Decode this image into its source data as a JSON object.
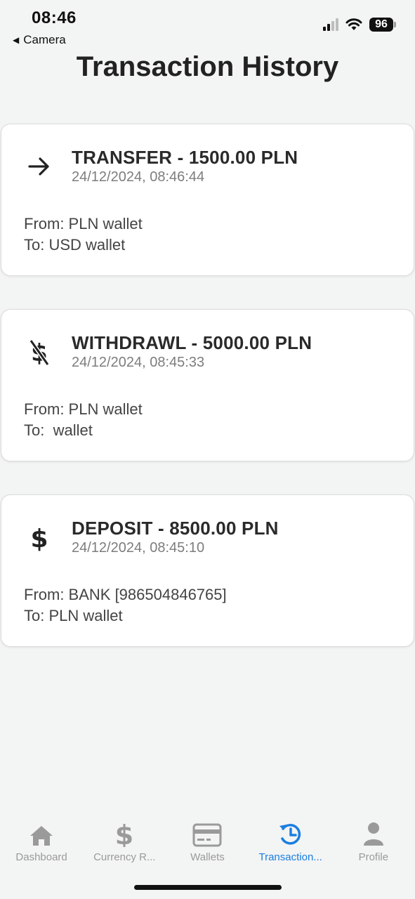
{
  "status_bar": {
    "time": "08:46",
    "back_app": "Camera",
    "battery": "96"
  },
  "page": {
    "title": "Transaction History"
  },
  "transactions": [
    {
      "icon": "arrow-right-icon",
      "title": "TRANSFER - 1500.00 PLN",
      "date": "24/12/2024, 08:46:44",
      "from": "From: PLN wallet",
      "to": "To: USD wallet"
    },
    {
      "icon": "dollar-off-icon",
      "title": "WITHDRAWL - 5000.00 PLN",
      "date": "24/12/2024, 08:45:33",
      "from": "From: PLN wallet",
      "to": "To:  wallet"
    },
    {
      "icon": "dollar-icon",
      "title": "DEPOSIT - 8500.00 PLN",
      "date": "24/12/2024, 08:45:10",
      "from": "From: BANK [986504846765]",
      "to": "To: PLN wallet"
    }
  ],
  "tabs": [
    {
      "label": "Dashboard",
      "icon": "home-icon",
      "active": false
    },
    {
      "label": "Currency R...",
      "icon": "dollar-icon",
      "active": false
    },
    {
      "label": "Wallets",
      "icon": "credit-card-icon",
      "active": false
    },
    {
      "label": "Transaction...",
      "icon": "history-icon",
      "active": true
    },
    {
      "label": "Profile",
      "icon": "person-icon",
      "active": false
    }
  ],
  "colors": {
    "background": "#f3f4f4",
    "active_tab": "#1a7ee0",
    "inactive_tab": "#9a9a9a"
  }
}
